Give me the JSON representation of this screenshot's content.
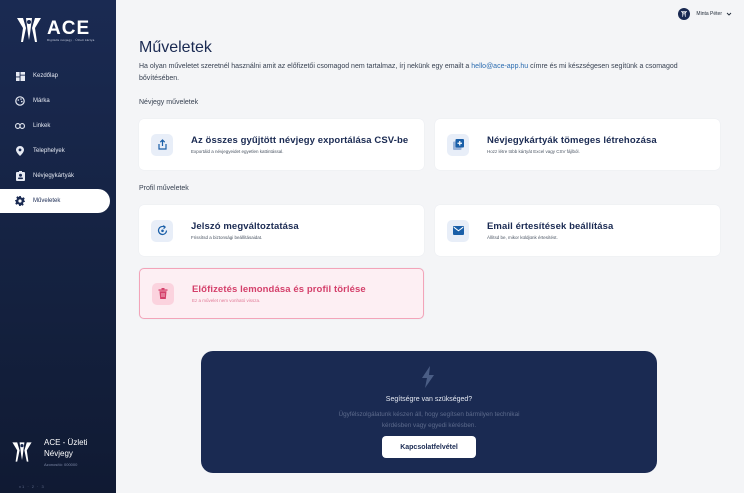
{
  "brand": {
    "logo_word": "ACE",
    "logo_sub": "Digitális névjegy · Üzleti kártya"
  },
  "sidebar": {
    "items": [
      {
        "label": "Kezdőlap",
        "icon": "dashboard-icon"
      },
      {
        "label": "Márka",
        "icon": "palette-icon"
      },
      {
        "label": "Linkek",
        "icon": "link-icon"
      },
      {
        "label": "Telephelyek",
        "icon": "location-pin-icon"
      },
      {
        "label": "Névjegykártyák",
        "icon": "contact-card-icon"
      },
      {
        "label": "Műveletek",
        "icon": "gear-icon",
        "active": true
      }
    ],
    "company_name": "ACE - Üzleti Névjegy",
    "company_sub": "Azonosító: 000000",
    "version": "v1 · 2 · 3"
  },
  "user": {
    "name": "Minta Péter"
  },
  "page": {
    "title": "Műveletek",
    "intro_before": "Ha olyan műveletet szeretnél használni amit az előfizetői csomagod nem tartalmaz, írj nekünk egy emailt a ",
    "intro_email": "hello@ace-app.hu",
    "intro_after": " címre és mi készségesen segítünk a csomagod bővítésében."
  },
  "sections": {
    "card_actions": "Névjegy műveletek",
    "profile_actions": "Profil műveletek"
  },
  "cards": {
    "export": {
      "title": "Az összes gyűjtött névjegy exportálása CSV-be",
      "desc": "Exportáld a névjegyeidet egyetlen kattintással."
    },
    "bulk": {
      "title": "Névjegykártyák tömeges létrehozása",
      "desc": "Hozz létre több kártyát Excel vagy CSV fájlból."
    },
    "password": {
      "title": "Jelszó megváltoztatása",
      "desc": "Frissítsd a biztonsági beállításaidat."
    },
    "email": {
      "title": "Email értesítések beállítása",
      "desc": "Állítsd be, mikor küldjünk értesítést."
    },
    "delete": {
      "title": "Előfizetés lemondása és profil törlése",
      "desc": "Ez a művelet nem vonható vissza."
    }
  },
  "help": {
    "title": "Segítségre van szükséged?",
    "text": "Ügyfélszolgálatunk készen áll, hogy segítsen bármilyen technikai kérdésben vagy egyedi kérésben.",
    "button": "Kapcsolatfelvétel"
  },
  "colors": {
    "sidebar": "#1a2a52",
    "accent": "#1a2a52",
    "danger": "#d43f6a",
    "link": "#2b6cb0"
  }
}
